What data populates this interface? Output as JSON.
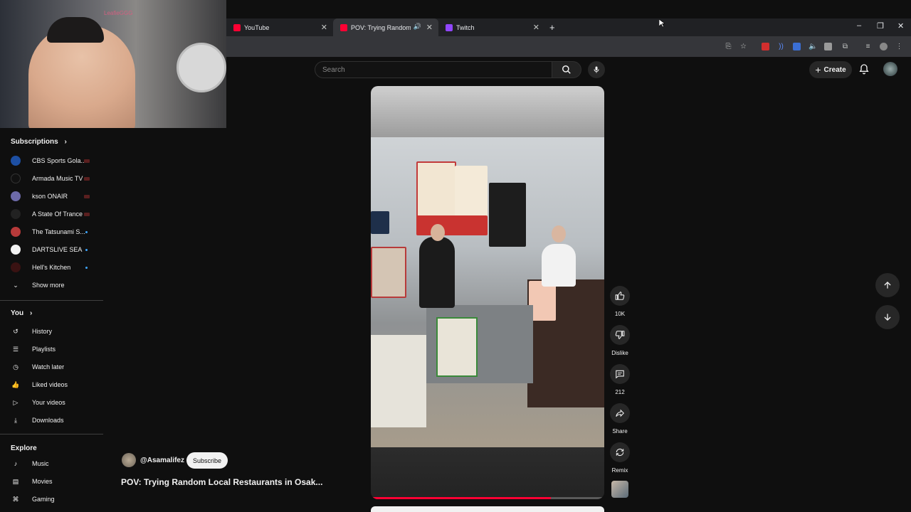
{
  "browser": {
    "tabs": [
      {
        "title": "YouTube",
        "favicon_color": "#ff0033",
        "active": false
      },
      {
        "title": "POV: Trying Random Local R",
        "favicon_color": "#ff0033",
        "active": true,
        "audio_icon": "speaker-icon"
      },
      {
        "title": "Twitch",
        "favicon_color": "#9146ff",
        "active": false
      }
    ],
    "new_tab_icon": "plus-icon"
  },
  "webcam": {
    "wall_logo": "LeafieGGG"
  },
  "header": {
    "search_placeholder": "Search",
    "create_label": "Create"
  },
  "sidebar": {
    "subscriptions_title": "Subscriptions",
    "subscriptions": [
      {
        "name": "CBS Sports Gola...",
        "avatar_color": "#1d4fa3",
        "status": "live"
      },
      {
        "name": "Armada Music TV",
        "avatar_color": "#111111",
        "status": "live"
      },
      {
        "name": "kson ONAIR",
        "avatar_color": "#6d6aa8",
        "status": "live"
      },
      {
        "name": "A State Of Trance",
        "avatar_color": "#222222",
        "status": "live"
      },
      {
        "name": "The Tatsunami S...",
        "avatar_color": "#b73a3a",
        "status": "new"
      },
      {
        "name": "DARTSLIVE SEA",
        "avatar_color": "#f1f1f1",
        "status": "new"
      },
      {
        "name": "Hell's Kitchen",
        "avatar_color": "#3a1212",
        "status": "new"
      }
    ],
    "show_more": "Show more",
    "you_title": "You",
    "you_items": [
      {
        "label": "History",
        "icon": "history-icon"
      },
      {
        "label": "Playlists",
        "icon": "playlists-icon"
      },
      {
        "label": "Watch later",
        "icon": "clock-icon"
      },
      {
        "label": "Liked videos",
        "icon": "thumbs-up-icon"
      },
      {
        "label": "Your videos",
        "icon": "play-square-icon"
      },
      {
        "label": "Downloads",
        "icon": "download-icon"
      }
    ],
    "explore_title": "Explore",
    "explore_items": [
      {
        "label": "Music",
        "icon": "music-note-icon"
      },
      {
        "label": "Movies",
        "icon": "film-icon"
      },
      {
        "label": "Gaming",
        "icon": "gamepad-icon"
      }
    ]
  },
  "short": {
    "channel": "@Asamalifez",
    "subscribe_label": "Subscribe",
    "title": "POV: Trying Random Local Restaurants in Osak...",
    "progress": 0.77
  },
  "actions": {
    "like_count": "10K",
    "dislike_label": "Dislike",
    "comment_count": "212",
    "share_label": "Share",
    "remix_label": "Remix"
  }
}
